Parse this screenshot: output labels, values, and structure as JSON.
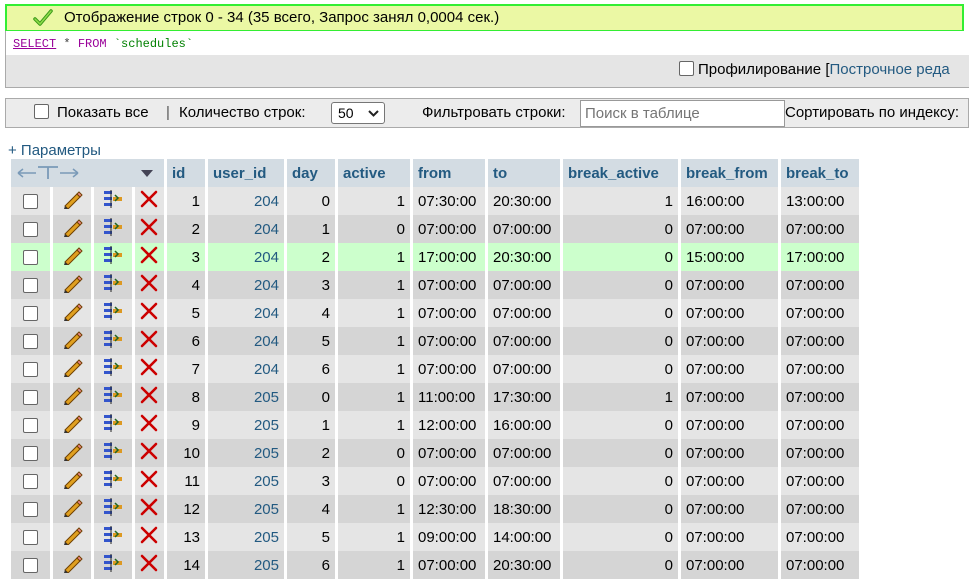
{
  "message": {
    "text": "Отображение строк 0 - 34 (35 всего, Запрос занял 0,0004 сек.)"
  },
  "sql": {
    "select": "SELECT",
    "star": "*",
    "from": "FROM",
    "table": "`schedules`"
  },
  "profiling": {
    "label": "Профилирование",
    "open_bracket": "[",
    "link": "Построчное реда"
  },
  "nav": {
    "show_all": "Показать все",
    "separator": "|",
    "rows_label": "Количество строк:",
    "rows_value": "50",
    "filter_label": "Фильтровать строки:",
    "search_placeholder": "Поиск в таблице",
    "sort_label": "Сортировать по индексу:"
  },
  "parameters_link": "+ Параметры",
  "table": {
    "columns": [
      "id",
      "user_id",
      "day",
      "active",
      "from",
      "to",
      "break_active",
      "break_from",
      "break_to"
    ],
    "rows": [
      [
        "1",
        "204",
        "0",
        "1",
        "07:30:00",
        "20:30:00",
        "1",
        "16:00:00",
        "13:00:00"
      ],
      [
        "2",
        "204",
        "1",
        "0",
        "07:00:00",
        "07:00:00",
        "0",
        "07:00:00",
        "07:00:00"
      ],
      [
        "3",
        "204",
        "2",
        "1",
        "17:00:00",
        "20:30:00",
        "0",
        "15:00:00",
        "17:00:00"
      ],
      [
        "4",
        "204",
        "3",
        "1",
        "07:00:00",
        "07:00:00",
        "0",
        "07:00:00",
        "07:00:00"
      ],
      [
        "5",
        "204",
        "4",
        "1",
        "07:00:00",
        "07:00:00",
        "0",
        "07:00:00",
        "07:00:00"
      ],
      [
        "6",
        "204",
        "5",
        "1",
        "07:00:00",
        "07:00:00",
        "0",
        "07:00:00",
        "07:00:00"
      ],
      [
        "7",
        "204",
        "6",
        "1",
        "07:00:00",
        "07:00:00",
        "0",
        "07:00:00",
        "07:00:00"
      ],
      [
        "8",
        "205",
        "0",
        "1",
        "11:00:00",
        "17:30:00",
        "1",
        "07:00:00",
        "07:00:00"
      ],
      [
        "9",
        "205",
        "1",
        "1",
        "12:00:00",
        "16:00:00",
        "0",
        "07:00:00",
        "07:00:00"
      ],
      [
        "10",
        "205",
        "2",
        "0",
        "07:00:00",
        "07:00:00",
        "0",
        "07:00:00",
        "07:00:00"
      ],
      [
        "11",
        "205",
        "3",
        "0",
        "07:00:00",
        "07:00:00",
        "0",
        "07:00:00",
        "07:00:00"
      ],
      [
        "12",
        "205",
        "4",
        "1",
        "12:30:00",
        "18:30:00",
        "0",
        "07:00:00",
        "07:00:00"
      ],
      [
        "13",
        "205",
        "5",
        "1",
        "09:00:00",
        "14:00:00",
        "0",
        "07:00:00",
        "07:00:00"
      ],
      [
        "14",
        "205",
        "6",
        "1",
        "07:00:00",
        "20:30:00",
        "0",
        "07:00:00",
        "07:00:00"
      ]
    ],
    "highlighted_row": 3
  },
  "icons": {
    "success": "checkmark-icon",
    "edit": "pencil-icon",
    "copy": "insert-copy-icon",
    "delete": "red-x-icon",
    "column_resize": "column-arrows-icon",
    "sort_menu": "triangle-down-icon"
  },
  "colors": {
    "success_border": "#33ee33",
    "success_bg": "#ebf8a4",
    "header_bg": "#d3dce3",
    "link": "#235a81",
    "row_odd": "#e5e5e5",
    "row_even": "#d5d5d5",
    "row_marked": "#ccffcc",
    "delete_red": "#cc0000"
  }
}
